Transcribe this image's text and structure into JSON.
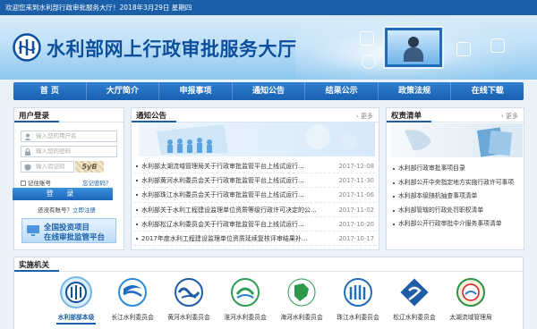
{
  "topbar": {
    "text": "欢迎您来到水利部行政审批服务大厅！2018年3月29日 星期四"
  },
  "header": {
    "title": "水利部网上行政审批服务大厅"
  },
  "nav": [
    "首  页",
    "大厅简介",
    "申报事项",
    "通知公告",
    "结果公示",
    "政策法规",
    "在线下载"
  ],
  "login": {
    "title": "用户登录",
    "username_placeholder": "输入您的用户名",
    "password_placeholder": "输入您的密码",
    "captcha_placeholder": "输入验证码",
    "captcha_text": "5yB",
    "remember": "记住账号",
    "forgot": "忘记密码？",
    "button": "登 录",
    "no_account": "还没有账号？",
    "register": "立即注册"
  },
  "invest": {
    "line1": "全国投资项目",
    "line2": "在线审批监管平台"
  },
  "notices": {
    "title": "通知公告",
    "more": "更多",
    "items": [
      {
        "text": "水利部太湖流域管理局关于行政审批监管平台上线试运行...",
        "date": "2017-12-08"
      },
      {
        "text": "水利部黄河水利委员会关于行政审批监管平台上线试运行...",
        "date": "2017-11-30"
      },
      {
        "text": "水利部珠江水利委员会关于行政审批监管平台上线试运行...",
        "date": "2017-11-06"
      },
      {
        "text": "水利部关于水利工程建设监理单位资质等级行政许可决定的公...",
        "date": "2017-11-02"
      },
      {
        "text": "水利部松辽水利委员会关于行政审批监管平台上线试运行...",
        "date": "2017-10-20"
      },
      {
        "text": "2017年度水利工程建设监理单位资质延续复核评审结果补...",
        "date": "2017-10-17"
      }
    ]
  },
  "rights": {
    "title": "权责清单",
    "more": "更多",
    "items": [
      "水利部行政审批事项目录",
      "水利部公开中央指定地方实施行政许可事项",
      "水利部本级随机抽查事项清单",
      "水利部管辖的行政处罚职权清单",
      "水利部公开行政审批中介服务事项清单"
    ]
  },
  "agencies": {
    "title": "实施机关",
    "items": [
      {
        "label": "水利部部本级",
        "active": true
      },
      {
        "label": "长江水利委员会",
        "active": false
      },
      {
        "label": "黄河水利委员会",
        "active": false
      },
      {
        "label": "淮河水利委员会",
        "active": false
      },
      {
        "label": "海河水利委员会",
        "active": false
      },
      {
        "label": "珠江水利委员会",
        "active": false
      },
      {
        "label": "松辽水利委员会",
        "active": false
      },
      {
        "label": "太湖流域管理局",
        "active": false
      }
    ]
  },
  "colors": {
    "brand": "#1a5fa8",
    "nav": "#1f6dbf",
    "accent_red": "#d9141b"
  }
}
